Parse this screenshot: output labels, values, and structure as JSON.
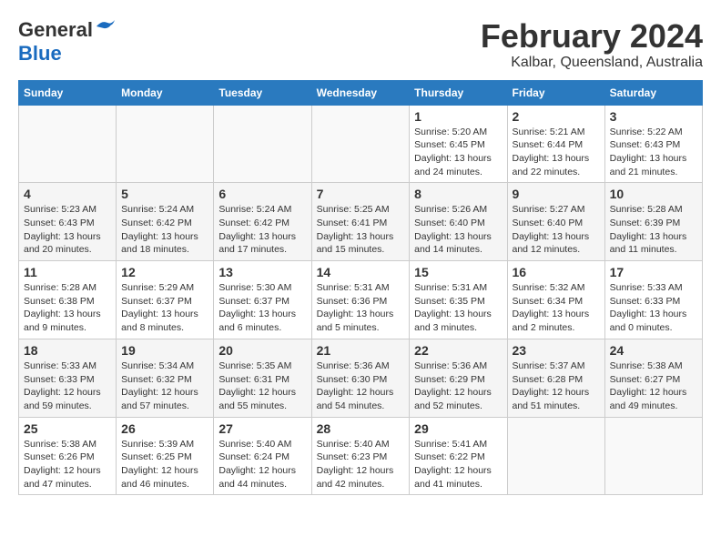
{
  "logo": {
    "general": "General",
    "blue": "Blue"
  },
  "header": {
    "title": "February 2024",
    "subtitle": "Kalbar, Queensland, Australia"
  },
  "weekdays": [
    "Sunday",
    "Monday",
    "Tuesday",
    "Wednesday",
    "Thursday",
    "Friday",
    "Saturday"
  ],
  "weeks": [
    [
      {
        "day": "",
        "info": ""
      },
      {
        "day": "",
        "info": ""
      },
      {
        "day": "",
        "info": ""
      },
      {
        "day": "",
        "info": ""
      },
      {
        "day": "1",
        "info": "Sunrise: 5:20 AM\nSunset: 6:45 PM\nDaylight: 13 hours\nand 24 minutes."
      },
      {
        "day": "2",
        "info": "Sunrise: 5:21 AM\nSunset: 6:44 PM\nDaylight: 13 hours\nand 22 minutes."
      },
      {
        "day": "3",
        "info": "Sunrise: 5:22 AM\nSunset: 6:43 PM\nDaylight: 13 hours\nand 21 minutes."
      }
    ],
    [
      {
        "day": "4",
        "info": "Sunrise: 5:23 AM\nSunset: 6:43 PM\nDaylight: 13 hours\nand 20 minutes."
      },
      {
        "day": "5",
        "info": "Sunrise: 5:24 AM\nSunset: 6:42 PM\nDaylight: 13 hours\nand 18 minutes."
      },
      {
        "day": "6",
        "info": "Sunrise: 5:24 AM\nSunset: 6:42 PM\nDaylight: 13 hours\nand 17 minutes."
      },
      {
        "day": "7",
        "info": "Sunrise: 5:25 AM\nSunset: 6:41 PM\nDaylight: 13 hours\nand 15 minutes."
      },
      {
        "day": "8",
        "info": "Sunrise: 5:26 AM\nSunset: 6:40 PM\nDaylight: 13 hours\nand 14 minutes."
      },
      {
        "day": "9",
        "info": "Sunrise: 5:27 AM\nSunset: 6:40 PM\nDaylight: 13 hours\nand 12 minutes."
      },
      {
        "day": "10",
        "info": "Sunrise: 5:28 AM\nSunset: 6:39 PM\nDaylight: 13 hours\nand 11 minutes."
      }
    ],
    [
      {
        "day": "11",
        "info": "Sunrise: 5:28 AM\nSunset: 6:38 PM\nDaylight: 13 hours\nand 9 minutes."
      },
      {
        "day": "12",
        "info": "Sunrise: 5:29 AM\nSunset: 6:37 PM\nDaylight: 13 hours\nand 8 minutes."
      },
      {
        "day": "13",
        "info": "Sunrise: 5:30 AM\nSunset: 6:37 PM\nDaylight: 13 hours\nand 6 minutes."
      },
      {
        "day": "14",
        "info": "Sunrise: 5:31 AM\nSunset: 6:36 PM\nDaylight: 13 hours\nand 5 minutes."
      },
      {
        "day": "15",
        "info": "Sunrise: 5:31 AM\nSunset: 6:35 PM\nDaylight: 13 hours\nand 3 minutes."
      },
      {
        "day": "16",
        "info": "Sunrise: 5:32 AM\nSunset: 6:34 PM\nDaylight: 13 hours\nand 2 minutes."
      },
      {
        "day": "17",
        "info": "Sunrise: 5:33 AM\nSunset: 6:33 PM\nDaylight: 13 hours\nand 0 minutes."
      }
    ],
    [
      {
        "day": "18",
        "info": "Sunrise: 5:33 AM\nSunset: 6:33 PM\nDaylight: 12 hours\nand 59 minutes."
      },
      {
        "day": "19",
        "info": "Sunrise: 5:34 AM\nSunset: 6:32 PM\nDaylight: 12 hours\nand 57 minutes."
      },
      {
        "day": "20",
        "info": "Sunrise: 5:35 AM\nSunset: 6:31 PM\nDaylight: 12 hours\nand 55 minutes."
      },
      {
        "day": "21",
        "info": "Sunrise: 5:36 AM\nSunset: 6:30 PM\nDaylight: 12 hours\nand 54 minutes."
      },
      {
        "day": "22",
        "info": "Sunrise: 5:36 AM\nSunset: 6:29 PM\nDaylight: 12 hours\nand 52 minutes."
      },
      {
        "day": "23",
        "info": "Sunrise: 5:37 AM\nSunset: 6:28 PM\nDaylight: 12 hours\nand 51 minutes."
      },
      {
        "day": "24",
        "info": "Sunrise: 5:38 AM\nSunset: 6:27 PM\nDaylight: 12 hours\nand 49 minutes."
      }
    ],
    [
      {
        "day": "25",
        "info": "Sunrise: 5:38 AM\nSunset: 6:26 PM\nDaylight: 12 hours\nand 47 minutes."
      },
      {
        "day": "26",
        "info": "Sunrise: 5:39 AM\nSunset: 6:25 PM\nDaylight: 12 hours\nand 46 minutes."
      },
      {
        "day": "27",
        "info": "Sunrise: 5:40 AM\nSunset: 6:24 PM\nDaylight: 12 hours\nand 44 minutes."
      },
      {
        "day": "28",
        "info": "Sunrise: 5:40 AM\nSunset: 6:23 PM\nDaylight: 12 hours\nand 42 minutes."
      },
      {
        "day": "29",
        "info": "Sunrise: 5:41 AM\nSunset: 6:22 PM\nDaylight: 12 hours\nand 41 minutes."
      },
      {
        "day": "",
        "info": ""
      },
      {
        "day": "",
        "info": ""
      }
    ]
  ]
}
